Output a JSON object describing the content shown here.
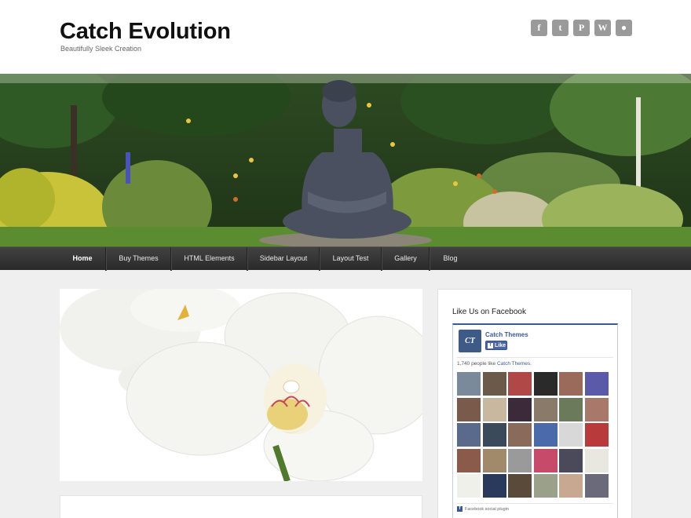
{
  "site": {
    "title": "Catch Evolution",
    "description": "Beautifully Sleek Creation"
  },
  "social": [
    {
      "icon": "facebook-icon",
      "glyph": "f"
    },
    {
      "icon": "twitter-icon",
      "glyph": "t"
    },
    {
      "icon": "pinterest-icon",
      "glyph": "P"
    },
    {
      "icon": "wordpress-icon",
      "glyph": "W"
    },
    {
      "icon": "github-icon",
      "glyph": "●"
    }
  ],
  "nav": {
    "items": [
      {
        "label": "Home",
        "active": true
      },
      {
        "label": "Buy Themes"
      },
      {
        "label": "HTML Elements"
      },
      {
        "label": "Sidebar Layout"
      },
      {
        "label": "Layout Test"
      },
      {
        "label": "Gallery"
      },
      {
        "label": "Blog"
      }
    ]
  },
  "widget": {
    "title": "Like Us on Facebook",
    "page_logo": "CT",
    "page_name": "Catch Themes",
    "like_label": "Like",
    "count_text": "1,740 people like",
    "count_link": "Catch Themes.",
    "plugin_label": "Facebook social plugin"
  },
  "colors": {
    "accent": "#3b5998",
    "nav_bg": "#333333",
    "page_bg": "#efefef"
  }
}
